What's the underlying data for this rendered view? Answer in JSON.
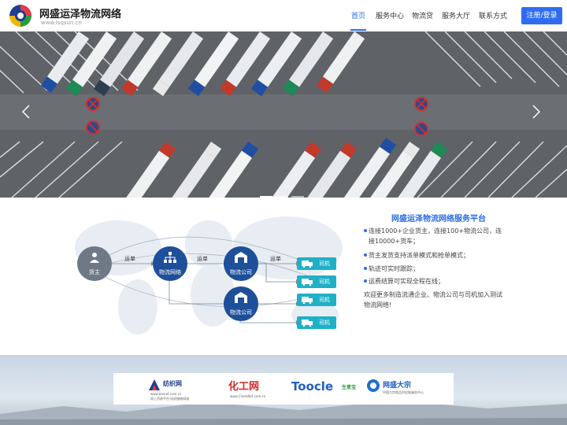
{
  "header": {
    "logo_title": "网盛运泽物流网络",
    "logo_url": "www.lsqsun.cn",
    "nav": [
      "首页",
      "服务中心",
      "物流贷",
      "服务大厅",
      "联系方式"
    ],
    "active_nav": "首页",
    "login_label": "注册/登录"
  },
  "hero": {
    "prev_icon": "chevron-left-icon",
    "next_icon": "chevron-right-icon",
    "slide_count": 3,
    "active_slide": 1
  },
  "platform": {
    "nodes": {
      "shipper": "货主",
      "network": "物流网络",
      "company_a": "物流公司",
      "company_b": "物流公司"
    },
    "edge_labels": [
      "运单",
      "运单",
      "运单"
    ],
    "drivers": [
      "司机",
      "司机",
      "司机",
      "司机"
    ],
    "title": "网盛运泽物流网络服务平台",
    "bullets": [
      "连接1000+企业货主，连接100+物流公司，连接10000+货车；",
      "货主发货支持派单模式和抢单模式；",
      "轨迹可实时跟踪；",
      "运费结算可实现全程在线；"
    ],
    "welcome": "欢迎更多制造流通企业、物流公司与司机加入测试物流网络!"
  },
  "partners": [
    {
      "name": "纺织网",
      "sub": "www.texnet.com.cn",
      "sub2": "网上贸易平台·纺织服装网络"
    },
    {
      "name": "化工网",
      "sub": "www.ChemNet.com.cn",
      "sub2": ""
    },
    {
      "name": "Toocle",
      "sub": "生意宝",
      "sub2": ""
    },
    {
      "name": "网盛大宗",
      "sub": "中国大宗商品供应链服务中心",
      "sub2": ""
    }
  ],
  "colors": {
    "brand_blue": "#2b6de5",
    "node_blue": "#1e4f9a",
    "driver_teal": "#1fb0c6"
  }
}
